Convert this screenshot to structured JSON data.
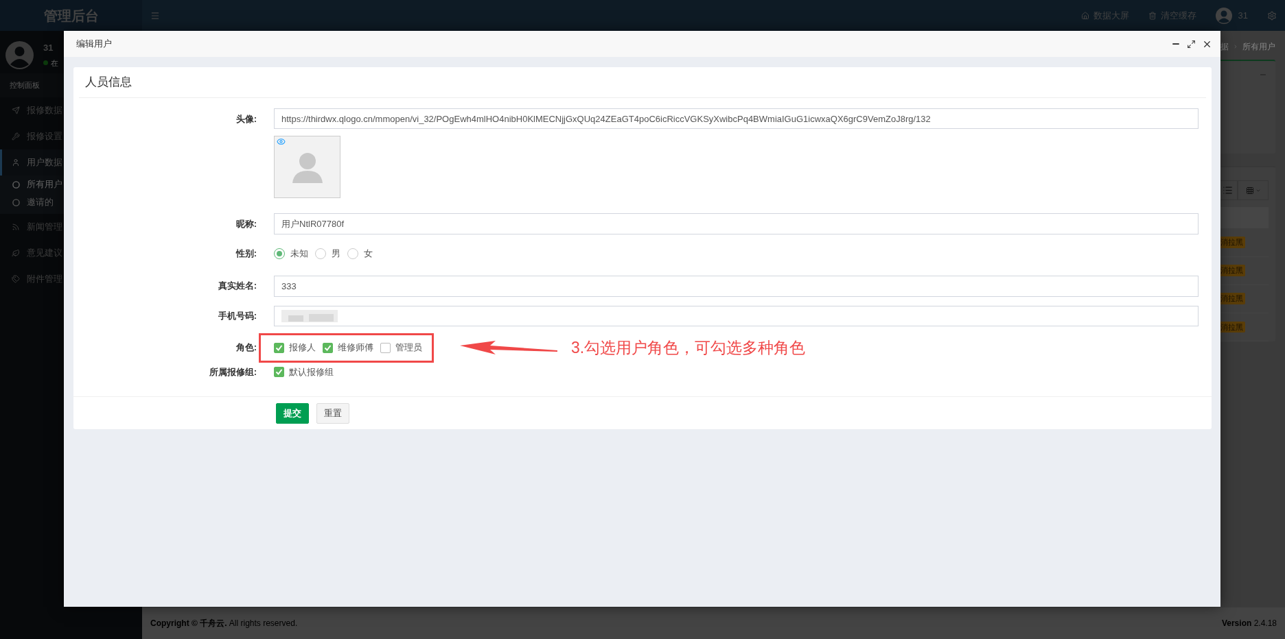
{
  "header": {
    "title": "管理后台",
    "actions": [
      {
        "kind": "home",
        "label": "数据大屏"
      },
      {
        "kind": "trash",
        "label": "清空缓存"
      }
    ],
    "user": "31"
  },
  "sidebar": {
    "user": {
      "name": "31",
      "status": "在"
    },
    "section": "控制面板",
    "items": [
      {
        "kind": "send",
        "label": "报修数据",
        "selected": false
      },
      {
        "kind": "wrench",
        "label": "报修设置",
        "selected": false
      },
      {
        "kind": "user",
        "label": "用户数据",
        "selected": true,
        "expanded": true,
        "children": [
          {
            "label": "所有用户",
            "selected": true
          },
          {
            "label": "邀请的",
            "selected": false
          }
        ]
      },
      {
        "kind": "rss",
        "label": "新闻管理",
        "selected": false
      },
      {
        "kind": "leaf",
        "label": "意见建议",
        "selected": false
      },
      {
        "kind": "tags",
        "label": "附件管理",
        "selected": false
      }
    ]
  },
  "breadcrumb": [
    "据",
    "所有用户"
  ],
  "table": {
    "rows": [
      {
        "action": "消拉黑"
      },
      {
        "action": "消拉黑"
      },
      {
        "action": "消拉黑"
      },
      {
        "action": "消拉黑"
      }
    ]
  },
  "modal": {
    "title": "编辑用户",
    "card": {
      "title": "人员信息",
      "fields": [
        {
          "kind": "avatar",
          "label": "头像:",
          "value": "https://thirdwx.qlogo.cn/mmopen/vi_32/POgEwh4mlHO4nibH0KlMECNjjGxQUq24ZEaGT4poC6icRiccVGKSyXwibcPq4BWmiaIGuG1icwxaQX6grC9VemZoJ8rg/132"
        },
        {
          "kind": "text",
          "label": "昵称:",
          "value": "用户NtlR07780f"
        },
        {
          "kind": "radio",
          "label": "性别:",
          "options": [
            {
              "label": "未知",
              "selected": true
            },
            {
              "label": "男",
              "selected": false
            },
            {
              "label": "女",
              "selected": false
            }
          ]
        },
        {
          "kind": "text",
          "label": "真实姓名:",
          "value": "333"
        },
        {
          "kind": "redacted",
          "label": "手机号码:"
        },
        {
          "kind": "checkbox",
          "label": "角色:",
          "options": [
            {
              "label": "报修人",
              "checked": true
            },
            {
              "label": "维修师傅",
              "checked": true
            },
            {
              "label": "管理员",
              "checked": false
            }
          ],
          "annotation": "3.勾选用户角色，可勾选多种角色"
        },
        {
          "kind": "checkbox",
          "label": "所属报修组:",
          "options": [
            {
              "label": "默认报修组",
              "checked": true
            }
          ]
        }
      ],
      "buttons": [
        {
          "kind": "primary",
          "label": "提交"
        },
        {
          "kind": "default",
          "label": "重置"
        }
      ]
    }
  },
  "footer": {
    "copyright": "**Copyright © 千舟云.** All rights reserved.",
    "version": "**Version** 2.4.18"
  }
}
